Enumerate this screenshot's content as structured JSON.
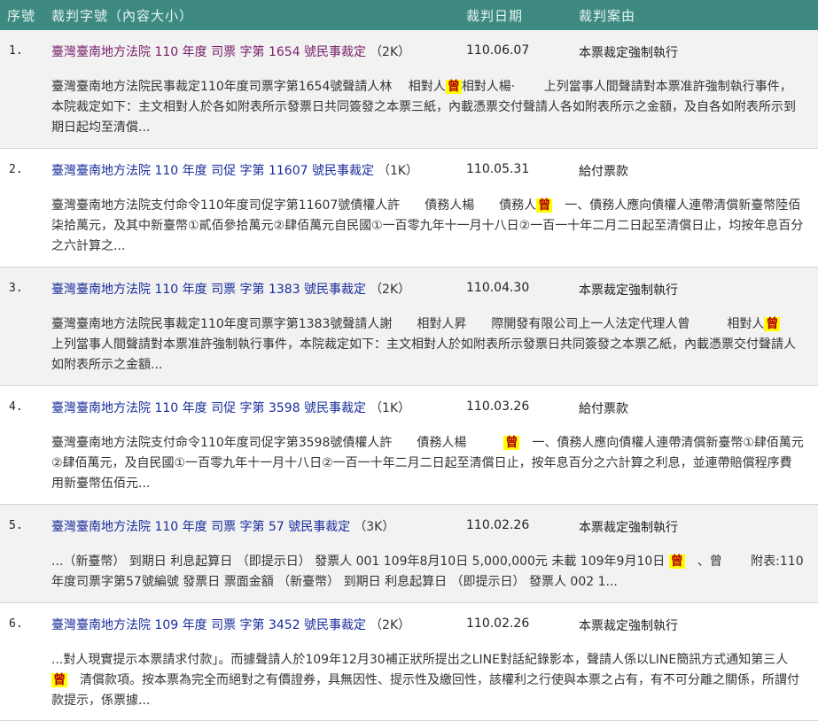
{
  "header": {
    "col_index": "序號",
    "col_title": "裁判字號（內容大小）",
    "col_date": "裁判日期",
    "col_cause": "裁判案由"
  },
  "rows": [
    {
      "num": "1.",
      "title": "臺灣臺南地方法院 110 年度 司票 字第 1654 號民事裁定",
      "size": "（2K）",
      "date": "110.06.07",
      "cause": "本票裁定強制執行",
      "visited": true,
      "snip_a": "臺灣臺南地方法院民事裁定110年度司票字第1654號聲請人林　 相對人",
      "snip_hl": "曾",
      "snip_b": "相對人楊·　 　上列當事人間聲請對本票准許強制執行事件，本院裁定如下：主文相對人於各如附表所示發票日共同簽發之本票三紙，內載憑票交付聲請人各如附表所示之金額，及自各如附表所示到期日起均至清償..."
    },
    {
      "num": "2.",
      "title": "臺灣臺南地方法院 110 年度 司促 字第 11607 號民事裁定",
      "size": "（1K）",
      "date": "110.05.31",
      "cause": "給付票款",
      "visited": false,
      "snip_a": "臺灣臺南地方法院支付命令110年度司促字第11607號債權人許　　債務人楊　　債務人",
      "snip_hl": "曾",
      "snip_b": "　一、債務人應向債權人連帶清償新臺幣陸佰柒拾萬元，及其中新臺幣①貳佰參拾萬元②肆佰萬元自民國①一百零九年十一月十八日②一百一十年二月二日起至清償日止，均按年息百分之六計算之..."
    },
    {
      "num": "3.",
      "title": "臺灣臺南地方法院 110 年度 司票 字第 1383 號民事裁定",
      "size": "（2K）",
      "date": "110.04.30",
      "cause": "本票裁定強制執行",
      "visited": false,
      "snip_a": "臺灣臺南地方法院民事裁定110年度司票字第1383號聲請人謝　　相對人昇　　際開發有限公司上一人法定代理人曾　　　相對人",
      "snip_hl": "曾",
      "snip_b": "　　上列當事人間聲請對本票准許強制執行事件，本院裁定如下：主文相對人於如附表所示發票日共同簽發之本票乙紙，內載憑票交付聲請人如附表所示之金額..."
    },
    {
      "num": "4.",
      "title": "臺灣臺南地方法院 110 年度 司促 字第 3598 號民事裁定",
      "size": "（1K）",
      "date": "110.03.26",
      "cause": "給付票款",
      "visited": false,
      "snip_a": "臺灣臺南地方法院支付命令110年度司促字第3598號債權人許　　債務人楊　　　",
      "snip_hl": "曾",
      "snip_b": "　一、債務人應向債權人連帶清償新臺幣①肆佰萬元②肆佰萬元，及自民國①一百零九年十一月十八日②一百一十年二月二日起至清償日止，按年息百分之六計算之利息，並連帶賠償程序費用新臺幣伍佰元..."
    },
    {
      "num": "5.",
      "title": "臺灣臺南地方法院 110 年度 司票 字第 57 號民事裁定",
      "size": "（3K）",
      "date": "110.02.26",
      "cause": "本票裁定強制執行",
      "visited": false,
      "snip_a": "...（新臺幣） 到期日 利息起算日 （即提示日） 發票人 001 109年8月10日 5,000,000元 未載 109年9月10日 ",
      "snip_hl": "曾",
      "snip_b": "　、曾　　 附表:110年度司票字第57號編號 發票日 票面金額 （新臺幣） 到期日 利息起算日 （即提示日） 發票人 002 1..."
    },
    {
      "num": "6.",
      "title": "臺灣臺南地方法院 109 年度 司票 字第 3452 號民事裁定",
      "size": "（2K）",
      "date": "110.02.26",
      "cause": "本票裁定強制執行",
      "visited": false,
      "snip_a": "...對人現實提示本票請求付款」。而據聲請人於109年12月30補正狀所提出之LINE對話紀錄影本，聲請人係以LINE簡訊方式通知第三人",
      "snip_hl": "曾",
      "snip_b": "　清償款項。按本票為完全而絕對之有價證券，具無因性、提示性及繳回性，該權利之行使與本票之占有，有不可分離之關係，所謂付款提示，係票據..."
    }
  ]
}
